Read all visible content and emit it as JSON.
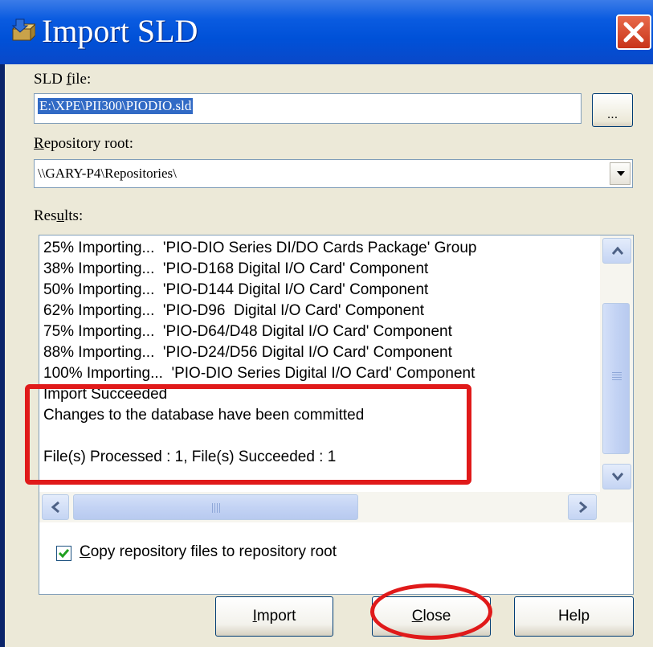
{
  "window": {
    "title": "Import SLD",
    "icon": "import-package-icon",
    "close_icon": "close-icon"
  },
  "sld_file": {
    "label_accel": "f",
    "label_pre": "SLD ",
    "label_post": "ile:",
    "value": "E:\\XPE\\PII300\\PIODIO.sld",
    "browse_label": "..."
  },
  "repository_root": {
    "label_accel": "R",
    "label_post": "epository root:",
    "value": "\\\\GARY-P4\\Repositories\\"
  },
  "results": {
    "label_pre": "Res",
    "label_accel": "u",
    "label_post": "lts:",
    "lines": [
      "25% Importing...  'PIO-DIO Series DI/DO Cards Package' Group",
      "38% Importing...  'PIO-D168 Digital I/O Card' Component",
      "50% Importing...  'PIO-D144 Digital I/O Card' Component",
      "62% Importing...  'PIO-D96  Digital I/O Card' Component",
      "75% Importing...  'PIO-D64/D48 Digital I/O Card' Component",
      "88% Importing...  'PIO-D24/D56 Digital I/O Card' Component",
      "100% Importing...  'PIO-DIO Series Digital I/O Card' Component",
      "Import Succeeded",
      "Changes to the database have been committed",
      "",
      "File(s) Processed : 1, File(s) Succeeded : 1"
    ]
  },
  "copy_checkbox": {
    "checked": true,
    "label_accel": "C",
    "label_post": "opy repository files to repository root"
  },
  "buttons": {
    "import_accel": "I",
    "import_post": "mport",
    "close_accel": "C",
    "close_post": "lose",
    "help": "Help"
  },
  "colors": {
    "titlebar": "#0054e3",
    "dialog_bg": "#ece9d8",
    "selection": "#316ac5",
    "highlight_annotation": "#e01a1a"
  }
}
